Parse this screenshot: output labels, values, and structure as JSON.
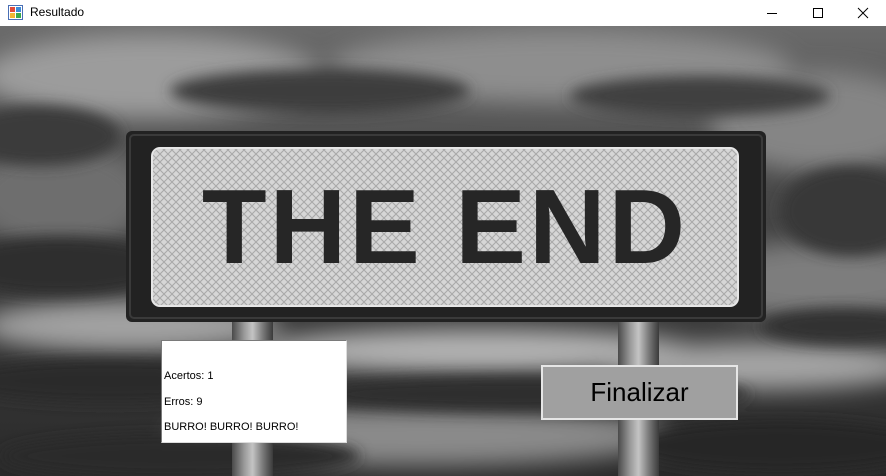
{
  "window": {
    "title": "Resultado",
    "app_icon": "winforms-app-icon",
    "controls": {
      "minimize_icon": "minimize-icon",
      "maximize_icon": "maximize-icon",
      "close_icon": "close-icon"
    }
  },
  "background": {
    "sign_text": "THE END",
    "sign_text_color": "#262626",
    "sky": "dark cloudy sky"
  },
  "result": {
    "hits": "Acertos: 1",
    "errors": "Erros: 9",
    "message": "BURRO! BURRO! BURRO!"
  },
  "actions": {
    "finish_label": "Finalizar",
    "finish_bg": "#a0a0a0"
  }
}
